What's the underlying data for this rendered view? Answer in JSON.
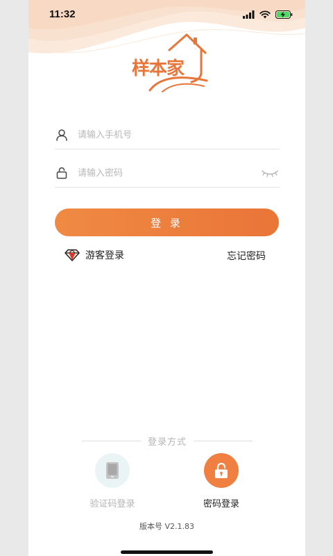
{
  "status_bar": {
    "time": "11:32"
  },
  "logo": {
    "text": "样本家"
  },
  "form": {
    "phone": {
      "placeholder": "请输入手机号",
      "value": ""
    },
    "password": {
      "placeholder": "请输入密码",
      "value": ""
    },
    "login_label": "登 录"
  },
  "links": {
    "guest_login": "游客登录",
    "forgot_password": "忘记密码"
  },
  "login_methods": {
    "title": "登录方式",
    "sms_label": "验证码登录",
    "password_label": "密码登录"
  },
  "version": "版本号 V2.1.83",
  "colors": {
    "accent": "#ea7538",
    "accent_light": "#ef8a43",
    "guest_icon_red": "#d9362b",
    "sms_circle": "#eaf4f4",
    "placeholder": "#b8b8b8"
  },
  "icons": {
    "phone_field": "user-icon",
    "password_field": "lock-icon",
    "password_toggle": "eye-closed-icon",
    "guest": "diamond-icon",
    "sms_method": "tablet-icon",
    "password_method": "padlock-icon"
  }
}
